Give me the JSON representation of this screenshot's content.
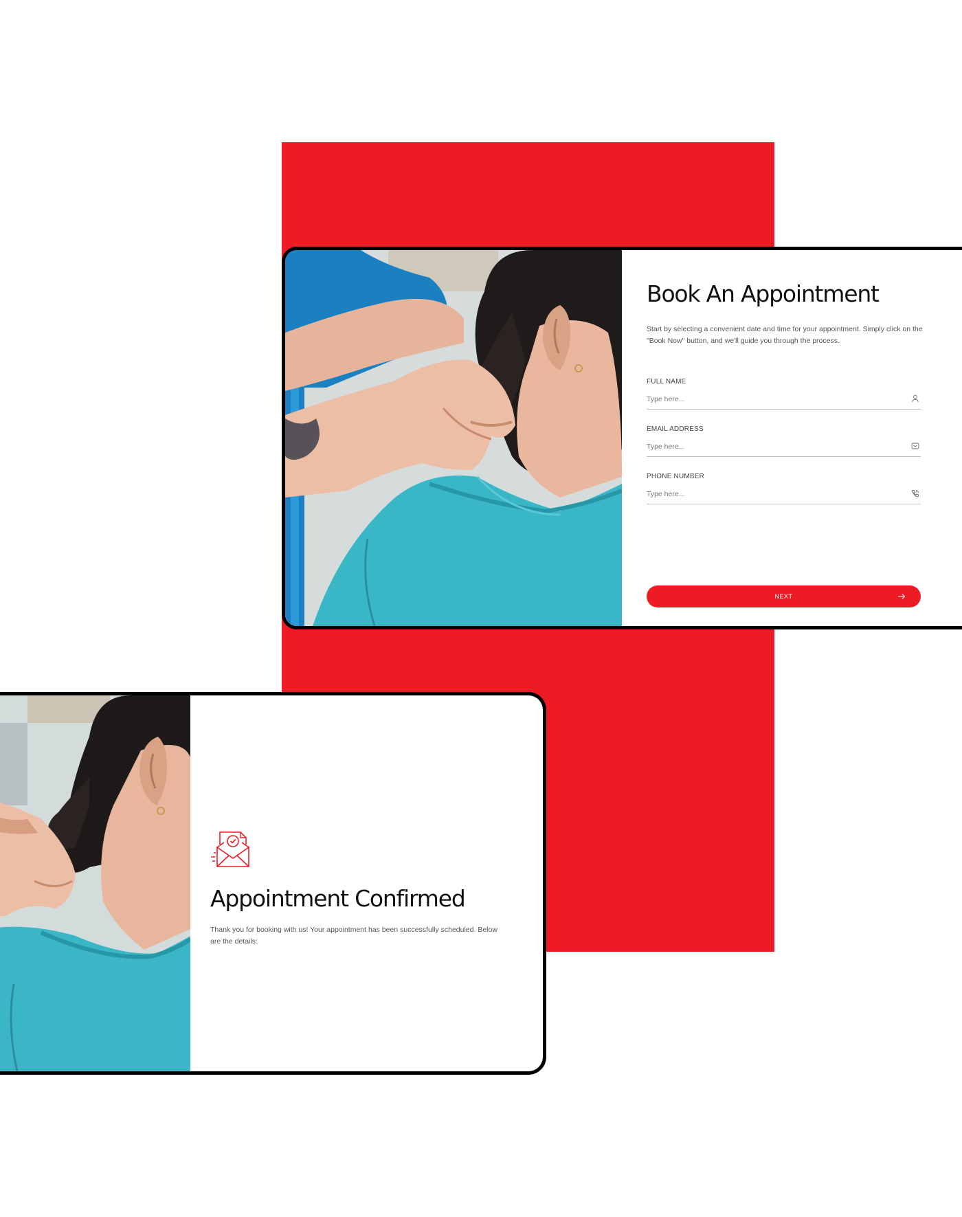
{
  "colors": {
    "accent": "#ed1c24",
    "border": "#000000",
    "text": "#111111"
  },
  "booking": {
    "title": "Book An Appointment",
    "description": "Start by selecting a convenient date and time for your appointment. Simply click on the \"Book Now\" button, and we'll guide you through the process.",
    "fields": [
      {
        "label": "FULL NAME",
        "placeholder": "Type here...",
        "icon": "user-icon"
      },
      {
        "label": "EMAIL ADDRESS",
        "placeholder": "Type here...",
        "icon": "mail-icon"
      },
      {
        "label": "PHONE NUMBER",
        "placeholder": "Type here...",
        "icon": "phone-icon"
      }
    ],
    "next_label": "NEXT",
    "next_icon": "arrow-right-icon"
  },
  "confirmation": {
    "icon": "envelope-check-icon",
    "title": "Appointment Confirmed",
    "description": "Thank you for booking with us! Your appointment has been successfully scheduled. Below are the details:"
  },
  "photo": {
    "subject": "therapist-neck-massage-photo"
  }
}
